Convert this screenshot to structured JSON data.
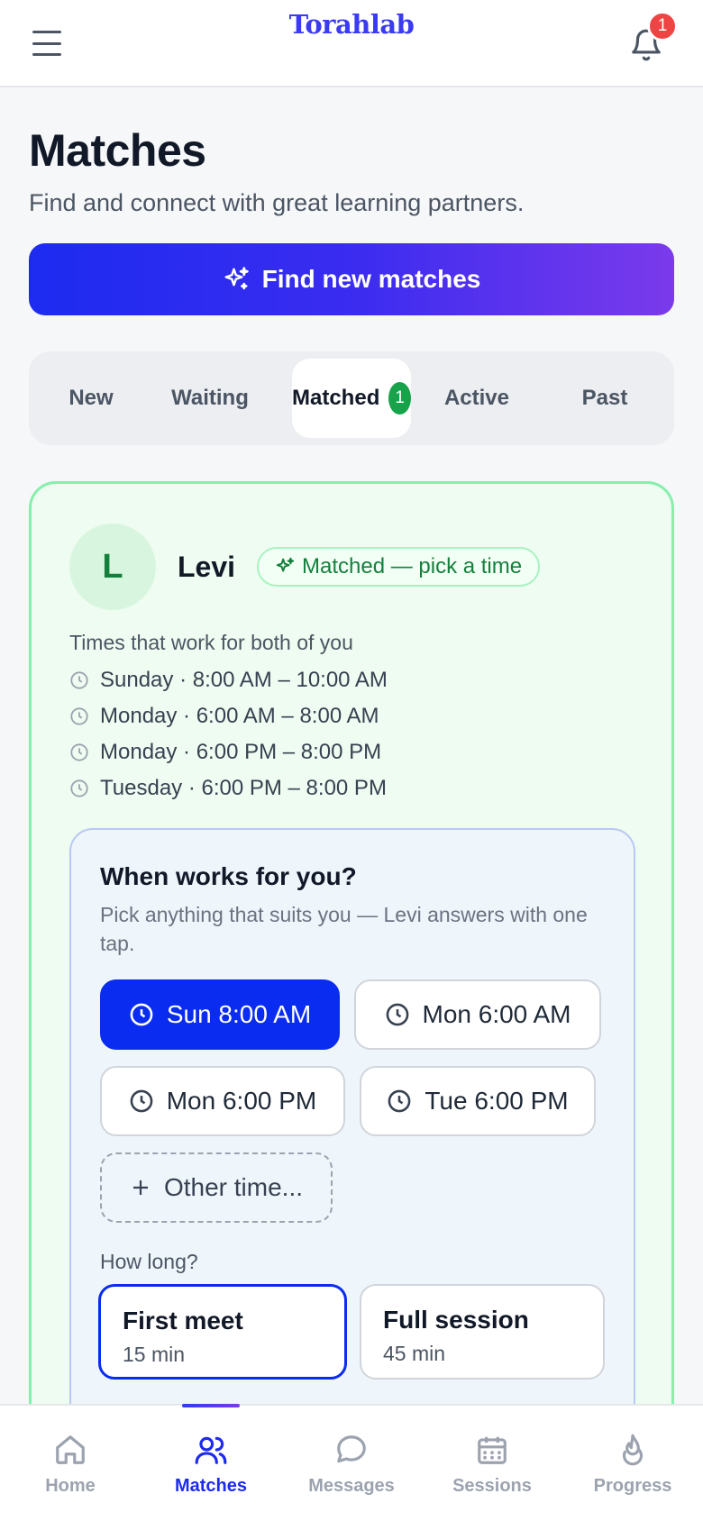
{
  "header": {
    "logo": "Torahlab",
    "notification_count": "1",
    "icons": {
      "menu": "hamburger-menu-icon",
      "bell": "bell-icon"
    }
  },
  "page": {
    "title": "Matches",
    "subtitle": "Find and connect with great learning partners.",
    "find_button_label": "Find new matches"
  },
  "tabs": [
    {
      "label": "New"
    },
    {
      "label": "Waiting"
    },
    {
      "label": "Matched",
      "badge": "1",
      "active": true
    },
    {
      "label": "Active"
    },
    {
      "label": "Past"
    }
  ],
  "match": {
    "avatar_initial": "L",
    "name": "Levi",
    "status": "Matched — pick a time",
    "times_title": "Times that work for both of you",
    "times": [
      "Sunday · 8:00 AM – 10:00 AM",
      "Monday · 6:00 AM – 8:00 AM",
      "Monday · 6:00 PM – 8:00 PM",
      "Tuesday · 6:00 PM – 8:00 PM"
    ],
    "picker": {
      "title": "When works for you?",
      "description": "Pick anything that suits you — Levi answers with one tap.",
      "options": [
        "Sun 8:00 AM",
        "Mon 6:00 AM",
        "Mon 6:00 PM",
        "Tue 6:00 PM"
      ],
      "selected_option": "Sun 8:00 AM",
      "other_label": "Other time...",
      "duration_title": "How long?",
      "durations": [
        {
          "title": "First meet",
          "sub": "15 min",
          "selected": true
        },
        {
          "title": "Full session",
          "sub": "45 min"
        }
      ]
    }
  },
  "bottom_nav": [
    {
      "label": "Home",
      "icon": "home-icon"
    },
    {
      "label": "Matches",
      "icon": "users-icon",
      "active": true
    },
    {
      "label": "Messages",
      "icon": "chat-bubble-icon"
    },
    {
      "label": "Sessions",
      "icon": "calendar-icon"
    },
    {
      "label": "Progress",
      "icon": "flame-icon"
    }
  ],
  "colors": {
    "accent": "#0a2cf0",
    "gradient_end": "#7b3aeb",
    "match_green": "#16a34a",
    "card_border": "#86efac",
    "notification_red": "#ef4444"
  }
}
